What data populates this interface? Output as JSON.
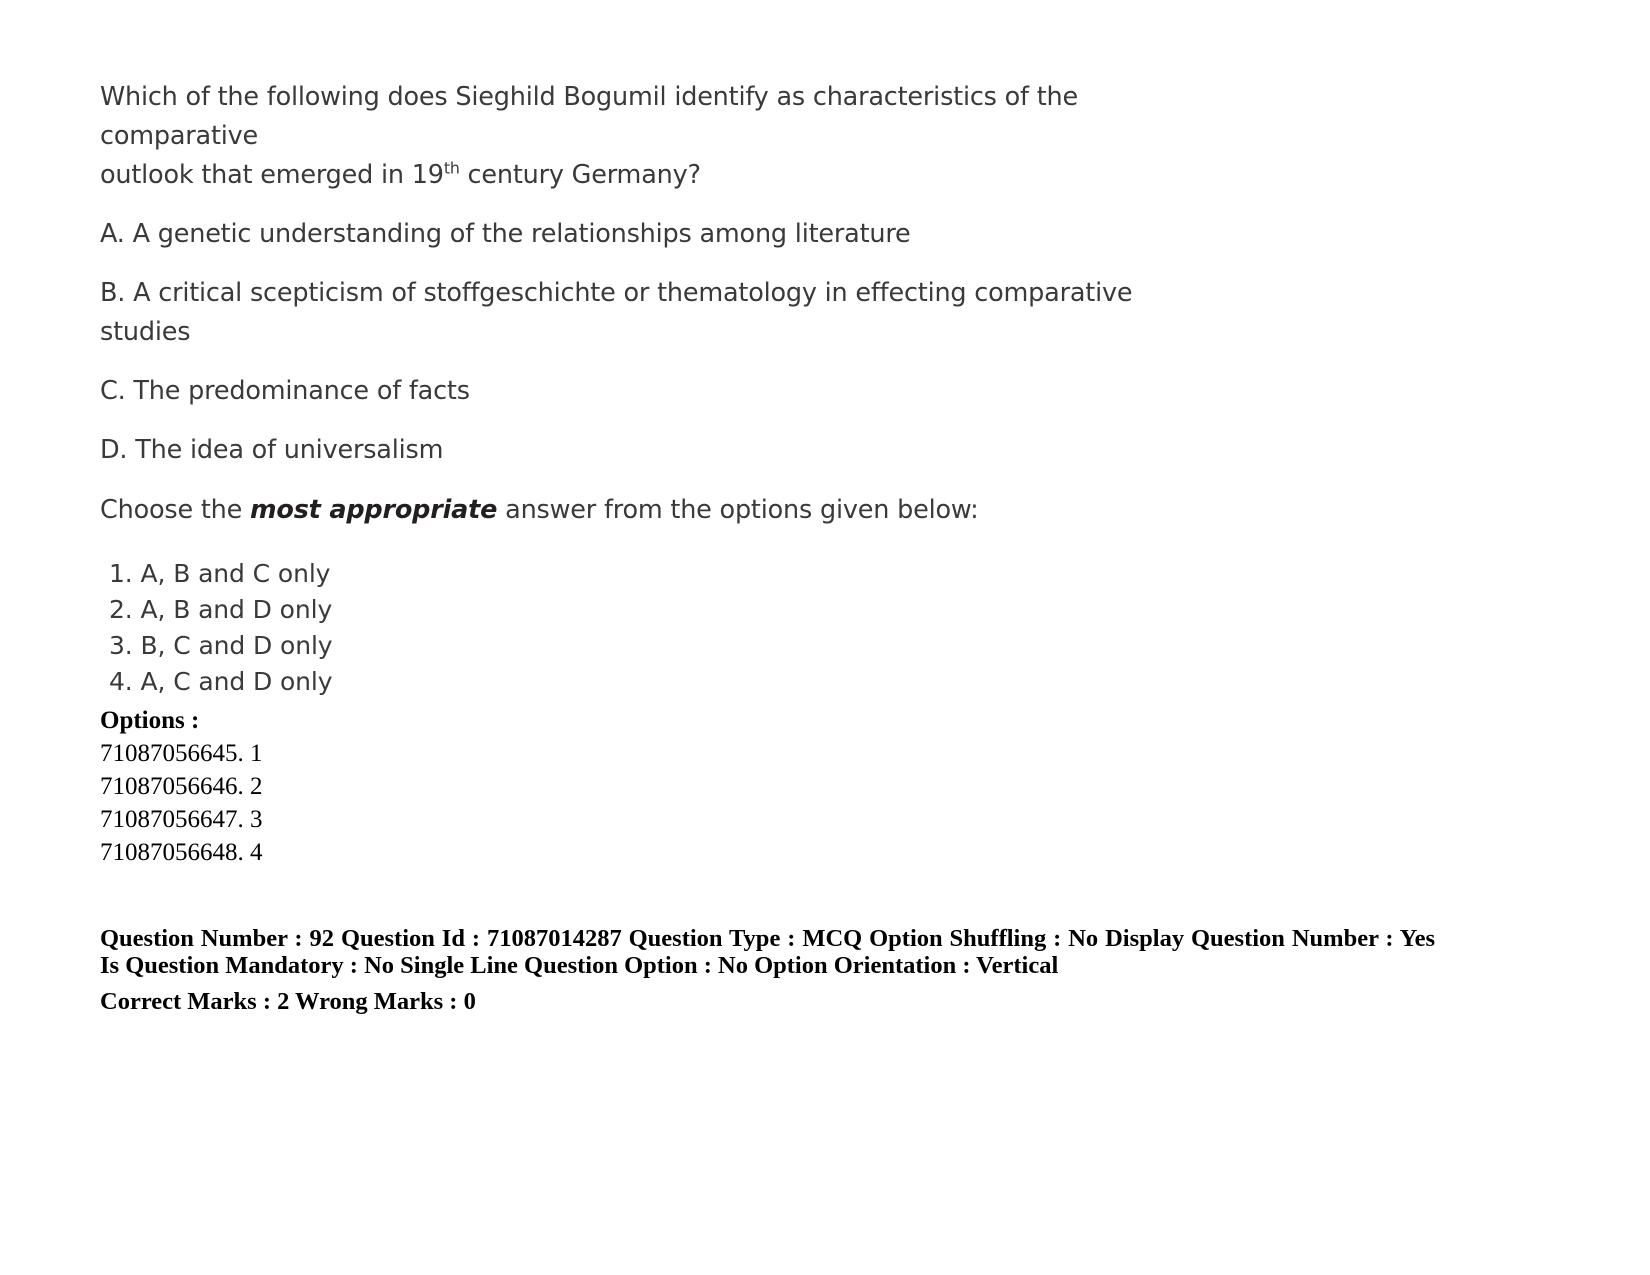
{
  "question": {
    "stem_line1": "Which of the following does Sieghild Bogumil identify as characteristics of the comparative",
    "stem_line2_before": "outlook that emerged in 19",
    "stem_superscript": "th",
    "stem_line2_after": " century Germany?",
    "statements": [
      "A. A genetic understanding of the relationships among literature",
      "B. A critical scepticism of stoffgeschichte or thematology in effecting comparative studies",
      "C. The predominance of facts",
      "D. The idea of universalism"
    ],
    "chooser_prefix": "Choose the ",
    "chooser_emphasis": "most appropriate",
    "chooser_suffix": " answer from the options given below:",
    "choices": [
      "1. A, B and C only",
      "2. A, B and D only",
      "3. B, C and D only",
      "4. A, C and D only"
    ]
  },
  "options": {
    "heading": "Options :",
    "items": [
      "71087056645. 1",
      "71087056646. 2",
      "71087056647. 3",
      "71087056648. 4"
    ]
  },
  "metadata": {
    "line": "Question Number : 92 Question Id : 71087014287 Question Type : MCQ Option Shuffling : No Display Question Number : Yes Is Question Mandatory : No Single Line Question Option : No Option Orientation : Vertical",
    "marks": "Correct Marks : 2 Wrong Marks : 0"
  }
}
